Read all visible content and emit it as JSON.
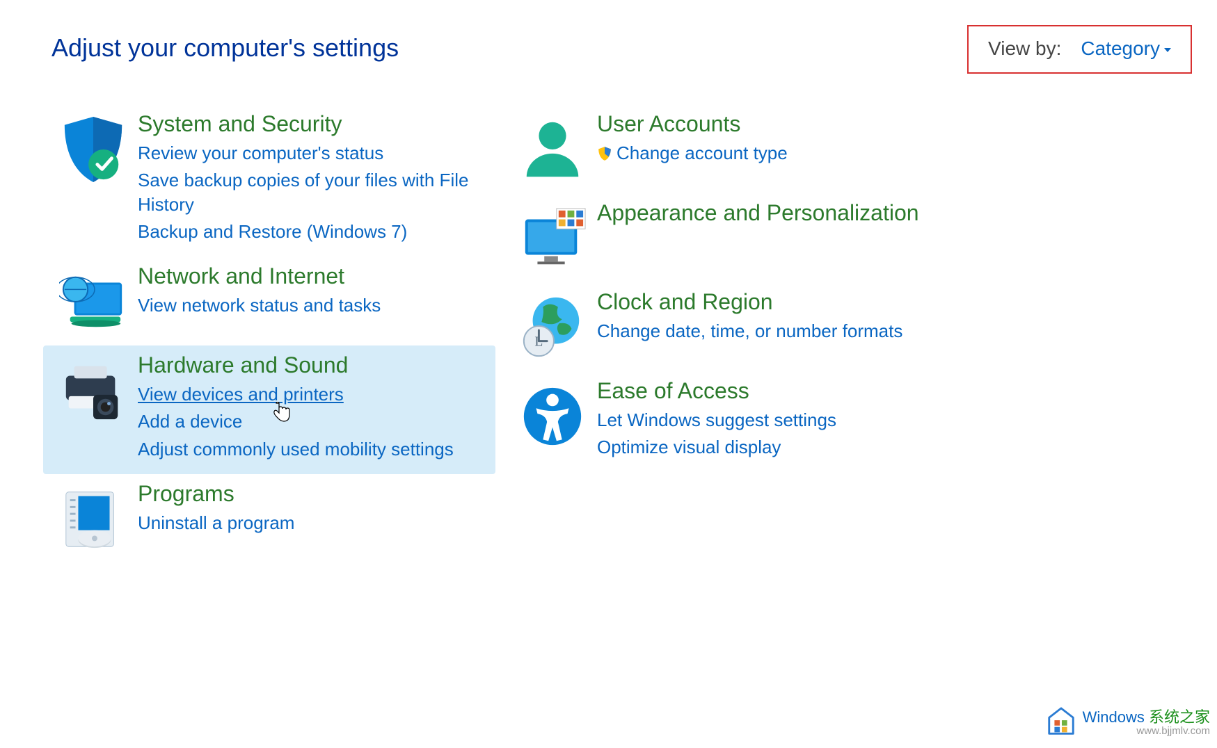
{
  "page_title": "Adjust your computer's settings",
  "viewby": {
    "label": "View by:",
    "value": "Category"
  },
  "left": {
    "system": {
      "title": "System and Security",
      "links": [
        "Review your computer's status",
        "Save backup copies of your files with File History",
        "Backup and Restore (Windows 7)"
      ]
    },
    "network": {
      "title": "Network and Internet",
      "links": [
        "View network status and tasks"
      ]
    },
    "hardware": {
      "title": "Hardware and Sound",
      "links": [
        "View devices and printers",
        "Add a device",
        "Adjust commonly used mobility settings"
      ]
    },
    "programs": {
      "title": "Programs",
      "links": [
        "Uninstall a program"
      ]
    }
  },
  "right": {
    "accounts": {
      "title": "User Accounts",
      "links": [
        "Change account type"
      ]
    },
    "appearance": {
      "title": "Appearance and Personalization"
    },
    "clock": {
      "title": "Clock and Region",
      "links": [
        "Change date, time, or number formats"
      ]
    },
    "ease": {
      "title": "Ease of Access",
      "links": [
        "Let Windows suggest settings",
        "Optimize visual display"
      ]
    }
  },
  "watermark": {
    "brand": "Windows",
    "brand_suffix": " 系统之家",
    "url": "www.bjjmlv.com"
  }
}
